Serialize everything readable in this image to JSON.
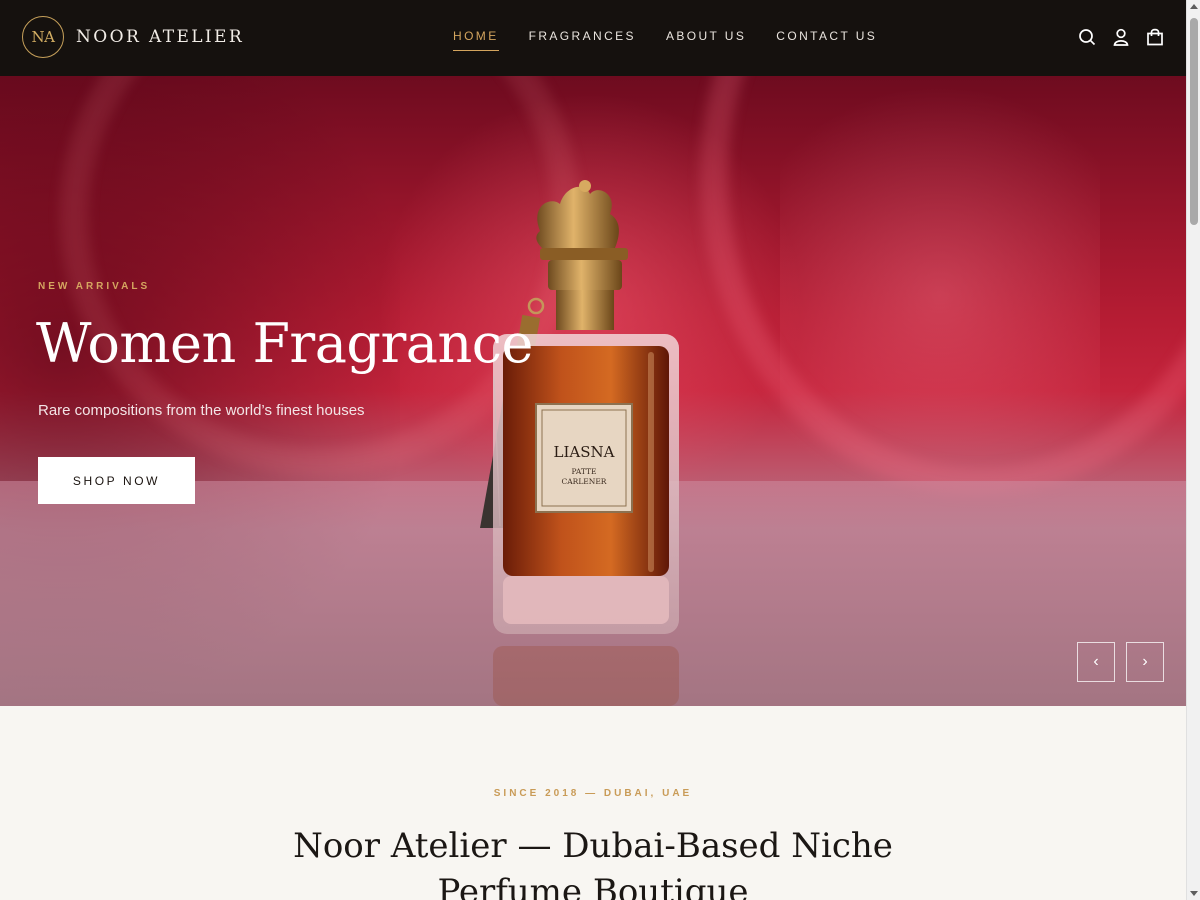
{
  "brand": {
    "monogram": "NA",
    "name": "NOOR ATELIER"
  },
  "nav": {
    "items": [
      {
        "label": "HOME",
        "active": true
      },
      {
        "label": "FRAGRANCES",
        "active": false
      },
      {
        "label": "ABOUT US",
        "active": false
      },
      {
        "label": "CONTACT US",
        "active": false
      }
    ]
  },
  "header_icons": [
    "search-icon",
    "account-icon",
    "cart-icon"
  ],
  "hero": {
    "eyebrow": "NEW ARRIVALS",
    "title": "Women Fragrance",
    "subtitle": "Rare compositions from the world’s finest houses",
    "cta_label": "SHOP NOW",
    "product_label": {
      "line1": "LIASNA",
      "line2": "PATTE",
      "line3": "CARLENER"
    },
    "carousel": {
      "prev_icon": "chevron-left-icon",
      "next_icon": "chevron-right-icon"
    }
  },
  "about": {
    "eyebrow": "SINCE 2018 — DUBAI, UAE",
    "title": "Noor Atelier — Dubai-Based Niche Perfume Boutique"
  },
  "colors": {
    "header_bg": "#15110e",
    "accent_gold": "#d4a55e",
    "hero_red": "#c4243c",
    "page_bg": "#f8f6f2"
  }
}
